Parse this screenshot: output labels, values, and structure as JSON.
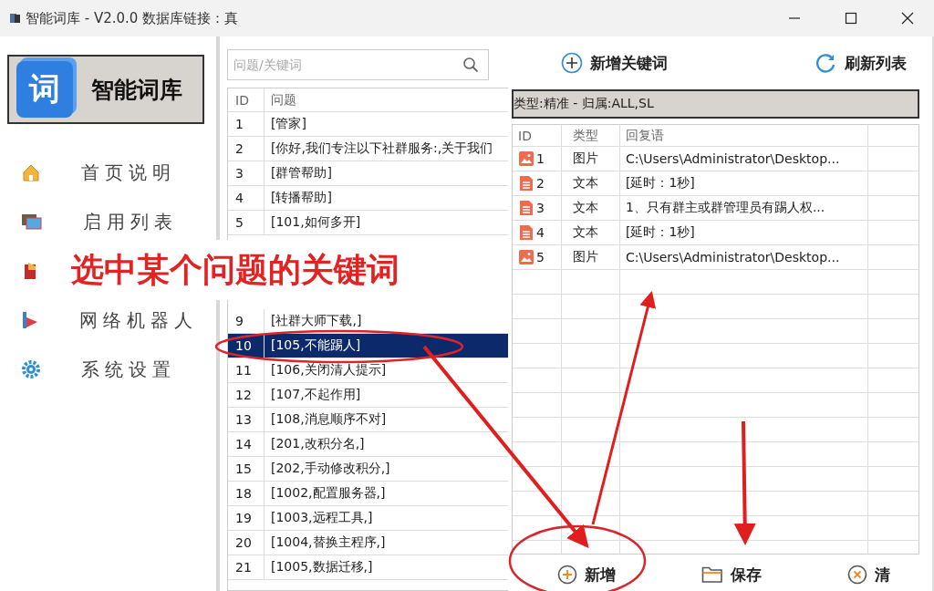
{
  "window": {
    "title": "智能词库 - V2.0.0  数据库链接：真"
  },
  "logo": {
    "glyph": "词",
    "name": "智能词库"
  },
  "nav": [
    {
      "label": "首页说明",
      "kind": "home"
    },
    {
      "label": "启用列表",
      "kind": "pictures"
    },
    {
      "kind": "book"
    },
    {
      "label": "网络机器人",
      "kind": "play"
    },
    {
      "label": "系统设置",
      "kind": "gear"
    }
  ],
  "search": {
    "placeholder": "问题/关键词"
  },
  "questions": {
    "columns": [
      "ID",
      "问题"
    ],
    "rows": [
      {
        "id": "1",
        "text": "[管家]",
        "selected": false
      },
      {
        "id": "2",
        "text": "[你好,我们专注以下社群服务:,关于我们",
        "selected": false
      },
      {
        "id": "3",
        "text": "[群管帮助]",
        "selected": false
      },
      {
        "id": "4",
        "text": "[转播帮助]",
        "selected": false
      },
      {
        "id": "5",
        "text": "[101,如何多开]",
        "selected": false
      },
      {
        "id": "9",
        "text": "[社群大师下载,]",
        "selected": false
      },
      {
        "id": "10",
        "text": "[105,不能踢人]",
        "selected": true
      },
      {
        "id": "11",
        "text": "[106,关闭清人提示]",
        "selected": false
      },
      {
        "id": "12",
        "text": "[107,不起作用]",
        "selected": false
      },
      {
        "id": "13",
        "text": "[108,消息顺序不对]",
        "selected": false
      },
      {
        "id": "14",
        "text": "[201,改积分名,]",
        "selected": false
      },
      {
        "id": "15",
        "text": "[202,手动修改积分,]",
        "selected": false
      },
      {
        "id": "18",
        "text": "[1002,配置服务器,]",
        "selected": false
      },
      {
        "id": "19",
        "text": "[1003,远程工具,]",
        "selected": false
      },
      {
        "id": "20",
        "text": "[1004,替换主程序,]",
        "selected": false
      },
      {
        "id": "21",
        "text": "[1005,数据迁移,]",
        "selected": false
      }
    ]
  },
  "toolbar": [
    {
      "label": "新增关键词",
      "kind": "add"
    },
    {
      "label": "刷新列表",
      "kind": "refresh"
    }
  ],
  "info_bar": "类型:精准 - 归属:ALL,SL",
  "replies": {
    "columns": [
      "ID",
      "类型",
      "回复语"
    ],
    "rows": [
      {
        "id": "1",
        "kind": "image",
        "type": "图片",
        "text": "C:\\Users\\Administrator\\Desktop..."
      },
      {
        "id": "2",
        "kind": "text",
        "type": "文本",
        "text": "[延时：1秒]"
      },
      {
        "id": "3",
        "kind": "text",
        "type": "文本",
        "text": "  1、只有群主或群管理员有踢人权..."
      },
      {
        "id": "4",
        "kind": "text",
        "type": "文本",
        "text": "[延时：1秒]"
      },
      {
        "id": "5",
        "kind": "image",
        "type": "图片",
        "text": "C:\\Users\\Administrator\\Desktop..."
      }
    ]
  },
  "bottom_buttons": [
    {
      "label": "新增",
      "kind": "add"
    },
    {
      "label": "保存",
      "kind": "folder"
    },
    {
      "label": "清",
      "kind": "clear"
    }
  ],
  "annotation": {
    "caption": "选中某个问题的关键词"
  }
}
